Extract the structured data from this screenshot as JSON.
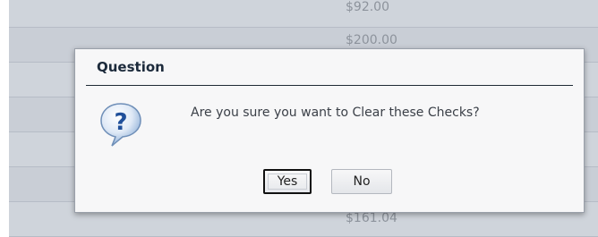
{
  "background": {
    "amounts": [
      "$92.00",
      "$200.00",
      "$161.04"
    ]
  },
  "dialog": {
    "title": "Question",
    "icon": "question-mark-icon",
    "message": "Are you sure you want to Clear these Checks?",
    "yes_label": "Yes",
    "no_label": "No"
  },
  "colors": {
    "overlay_row": "#c9ced6",
    "dialog_bg": "#f7f7f8",
    "title_text": "#1d2b3c",
    "icon_blue": "#1f5fb0"
  }
}
